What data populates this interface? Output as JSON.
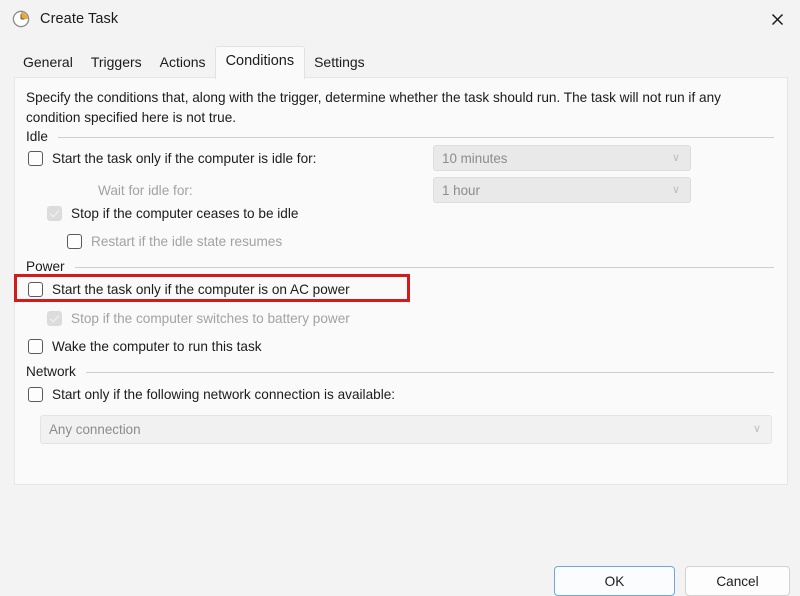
{
  "window": {
    "title": "Create Task",
    "icon": "clock-icon",
    "close_label": "✕"
  },
  "tabs": [
    {
      "label": "General",
      "active": false
    },
    {
      "label": "Triggers",
      "active": false
    },
    {
      "label": "Actions",
      "active": false
    },
    {
      "label": "Conditions",
      "active": true
    },
    {
      "label": "Settings",
      "active": false
    }
  ],
  "description": "Specify the conditions that, along with the trigger, determine whether the task should run.  The task will not run  if any condition specified here is not true.",
  "groups": {
    "idle": {
      "label": "Idle",
      "start_if_idle": {
        "label": "Start the task only if the computer is idle for:",
        "checked": false,
        "enabled": true
      },
      "idle_duration": {
        "value": "10 minutes",
        "enabled": false
      },
      "wait_for_idle_label": "Wait for idle for:",
      "wait_duration": {
        "value": "1 hour",
        "enabled": false
      },
      "stop_if_ceases_idle": {
        "label": "Stop if the computer ceases to be idle",
        "checked": true,
        "enabled": false
      },
      "restart_if_idle_resumes": {
        "label": "Restart if the idle state resumes",
        "checked": false,
        "enabled": true
      }
    },
    "power": {
      "label": "Power",
      "start_if_ac": {
        "label": "Start the task only if the computer is on AC power",
        "checked": false,
        "enabled": true,
        "highlighted": true
      },
      "stop_if_battery": {
        "label": "Stop if the computer switches to battery power",
        "checked": true,
        "enabled": false
      },
      "wake_computer": {
        "label": "Wake the computer to run this task",
        "checked": false,
        "enabled": true
      }
    },
    "network": {
      "label": "Network",
      "start_if_network": {
        "label": "Start only if the following network connection is available:",
        "checked": false,
        "enabled": true
      },
      "connection": {
        "value": "Any connection",
        "enabled": false
      }
    }
  },
  "footer": {
    "ok_label": "OK",
    "cancel_label": "Cancel"
  },
  "colors": {
    "highlight": "#d41a1a",
    "accent": "#6fa8dc",
    "window_bg": "#f3f3f3",
    "panel_bg": "#fafafa"
  },
  "chevron_glyph": "∨"
}
